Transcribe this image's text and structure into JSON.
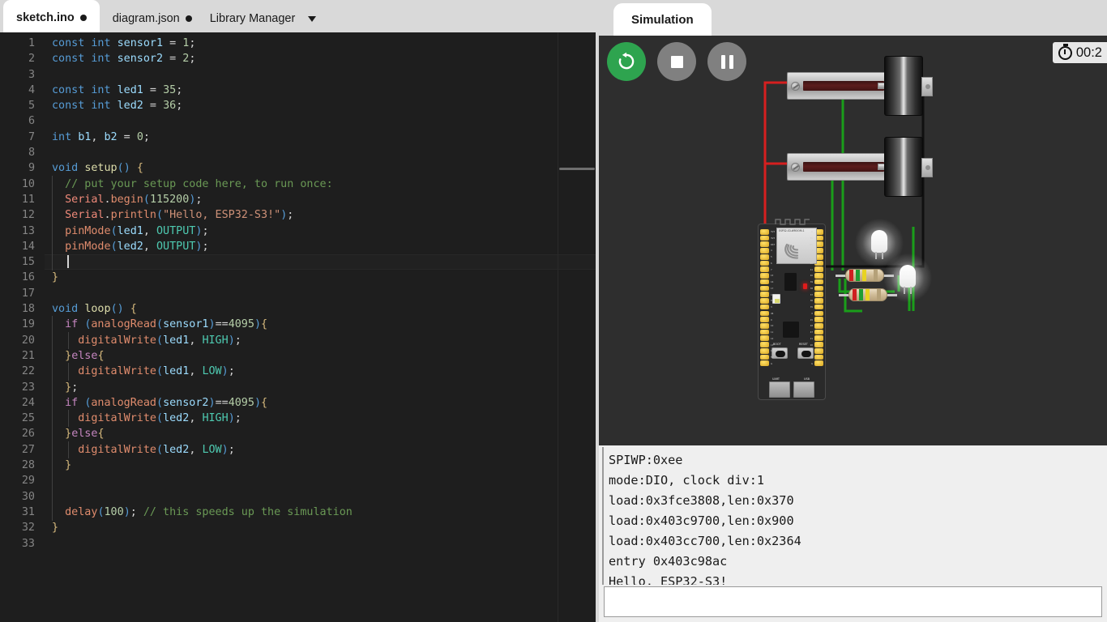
{
  "editor_tabs": [
    {
      "label": "sketch.ino",
      "modified": true,
      "active": true,
      "name": "tab-sketch-ino"
    },
    {
      "label": "diagram.json",
      "modified": true,
      "active": false,
      "name": "tab-diagram-json"
    }
  ],
  "library_manager": {
    "label": "Library Manager",
    "caret": "chevron-down-icon"
  },
  "code_lines": [
    {
      "n": 1,
      "indent": 0
    },
    {
      "n": 2,
      "indent": 0
    },
    {
      "n": 3,
      "indent": 0
    },
    {
      "n": 4,
      "indent": 0
    },
    {
      "n": 5,
      "indent": 0
    },
    {
      "n": 6,
      "indent": 0
    },
    {
      "n": 7,
      "indent": 0
    },
    {
      "n": 8,
      "indent": 0
    },
    {
      "n": 9,
      "indent": 0
    },
    {
      "n": 10,
      "indent": 1
    },
    {
      "n": 11,
      "indent": 1
    },
    {
      "n": 12,
      "indent": 1
    },
    {
      "n": 13,
      "indent": 1
    },
    {
      "n": 14,
      "indent": 1
    },
    {
      "n": 15,
      "indent": 1
    },
    {
      "n": 16,
      "indent": 0
    },
    {
      "n": 17,
      "indent": 0
    },
    {
      "n": 18,
      "indent": 0
    },
    {
      "n": 19,
      "indent": 1
    },
    {
      "n": 20,
      "indent": 2
    },
    {
      "n": 21,
      "indent": 1
    },
    {
      "n": 22,
      "indent": 2
    },
    {
      "n": 23,
      "indent": 1
    },
    {
      "n": 24,
      "indent": 1
    },
    {
      "n": 25,
      "indent": 2
    },
    {
      "n": 26,
      "indent": 1
    },
    {
      "n": 27,
      "indent": 2
    },
    {
      "n": 28,
      "indent": 1
    },
    {
      "n": 29,
      "indent": 1
    },
    {
      "n": 30,
      "indent": 1
    },
    {
      "n": 31,
      "indent": 1
    },
    {
      "n": 32,
      "indent": 0
    },
    {
      "n": 33,
      "indent": 0
    }
  ],
  "code_text": [
    "const int sensor1 = 1;",
    "const int sensor2 = 2;",
    "",
    "const int led1 = 35;",
    "const int led2 = 36;",
    "",
    "int b1, b2 = 0;",
    "",
    "void setup() {",
    "  // put your setup code here, to run once:",
    "  Serial.begin(115200);",
    "  Serial.println(\"Hello, ESP32-S3!\");",
    "  pinMode(led1, OUTPUT);",
    "  pinMode(led2, OUTPUT);",
    "",
    "}",
    "",
    "void loop() {",
    "  if (analogRead(sensor1)==4095){",
    "    digitalWrite(led1, HIGH);",
    "  }else{",
    "    digitalWrite(led1, LOW);",
    "  };",
    "  if (analogRead(sensor2)==4095){",
    "    digitalWrite(led2, HIGH);",
    "  }else{",
    "    digitalWrite(led2, LOW);",
    "  }",
    "",
    "",
    "  delay(100); // this speeds up the simulation",
    "}",
    ""
  ],
  "active_line": 15,
  "simulation": {
    "tab_label": "Simulation",
    "controls": [
      {
        "name": "restart-button",
        "icon": "restart-icon",
        "color": "#2ea44f"
      },
      {
        "name": "stop-button",
        "icon": "stop-icon",
        "color": "#808080"
      },
      {
        "name": "pause-button",
        "icon": "pause-icon",
        "color": "#808080"
      }
    ],
    "timer": {
      "icon": "stopwatch-icon",
      "value": "00:2"
    },
    "parts": {
      "board_label": "ESP32-S3-WROOM-1",
      "boot_label": "BOOT",
      "reset_label": "RESET",
      "uart_label": "UART",
      "usb_label": "USB",
      "pins_left": [
        "3V3",
        "3V3",
        "RST",
        "4",
        "5",
        "6",
        "7",
        "15",
        "16",
        "17",
        "18",
        "8",
        "3",
        "46",
        "9",
        "10",
        "11",
        "12",
        "13",
        "14",
        "5V",
        "G"
      ],
      "pins_right": [
        "G",
        "TX",
        "RX",
        "1",
        "2",
        "42",
        "41",
        "40",
        "39",
        "38",
        "37",
        "36",
        "35",
        "0",
        "45",
        "48",
        "47",
        "21",
        "20",
        "19",
        "G",
        "G"
      ],
      "potentiometers": 2,
      "leds": 2,
      "resistors": 2
    }
  },
  "serial_monitor": {
    "lines": [
      "SPIWP:0xee",
      "mode:DIO, clock div:1",
      "load:0x3fce3808,len:0x370",
      "load:0x403c9700,len:0x900",
      "load:0x403cc700,len:0x2364",
      "entry 0x403c98ac",
      "Hello, ESP32-S3!"
    ],
    "input_value": ""
  },
  "colors": {
    "accent_green": "#2ea44f",
    "tabbar_bg": "#d9d9d9",
    "editor_bg": "#1e1e1e",
    "sim_bg": "#2e2e2e",
    "serial_bg": "#efefef"
  }
}
